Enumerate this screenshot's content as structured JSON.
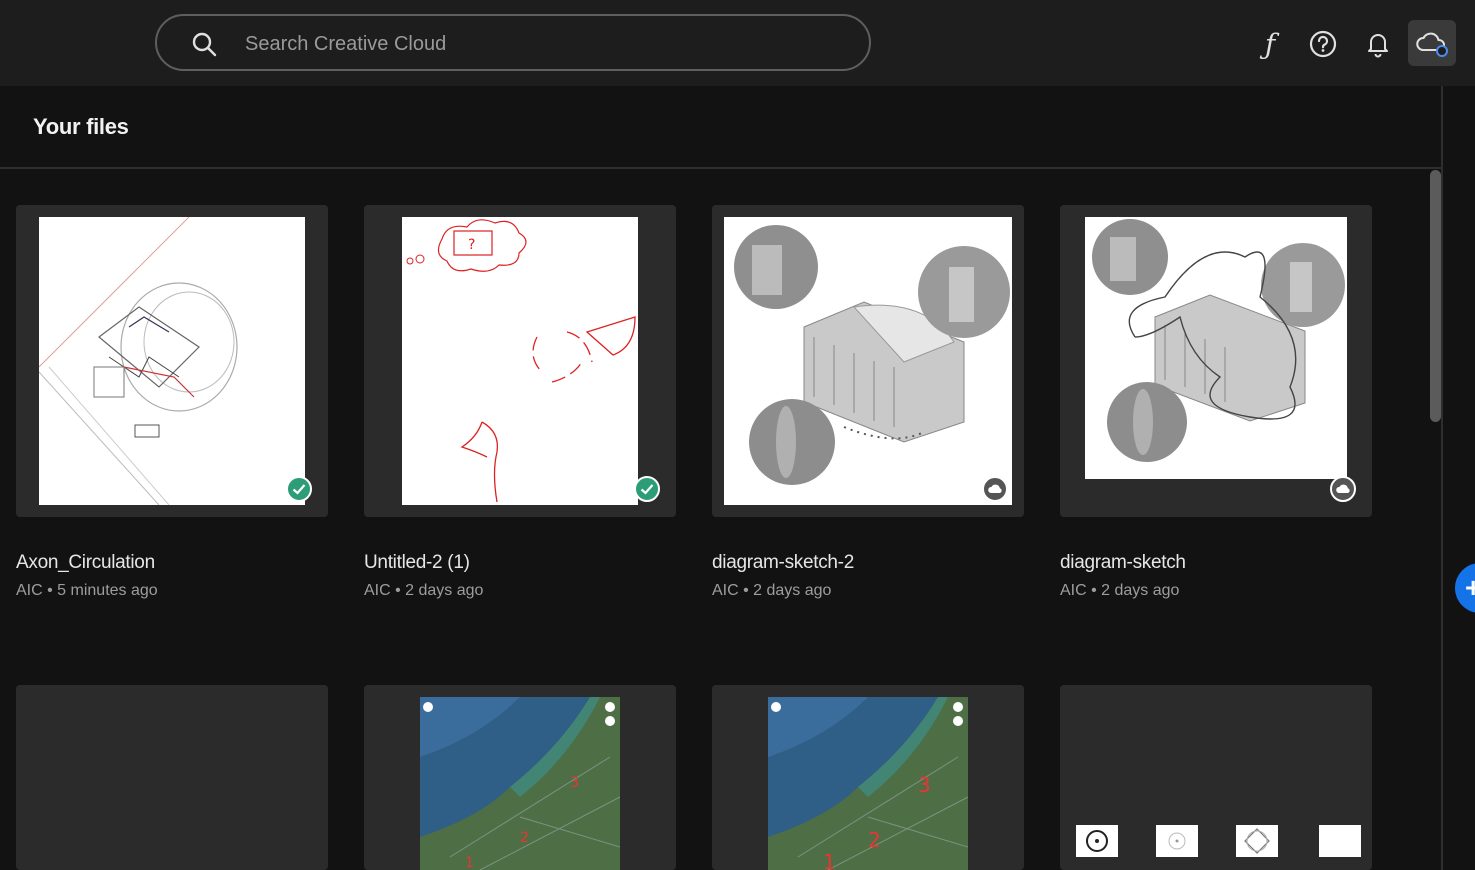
{
  "search": {
    "placeholder": "Search Creative Cloud",
    "icon": "search-icon"
  },
  "toolbar": {
    "icons": [
      "fonts-icon",
      "help-icon",
      "notifications-bell-icon",
      "cloud-sync-icon"
    ]
  },
  "page_title": "Your files",
  "files": [
    {
      "name": "Axon_Circulation",
      "meta": "AIC • 5 minutes ago",
      "status": "synced"
    },
    {
      "name": "Untitled-2 (1)",
      "meta": "AIC • 2 days ago",
      "status": "synced"
    },
    {
      "name": "diagram-sketch-2",
      "meta": "AIC • 2 days ago",
      "status": "cloud-only"
    },
    {
      "name": "diagram-sketch",
      "meta": "AIC • 2 days ago",
      "status": "cloud-only"
    }
  ],
  "colors": {
    "background": "#121212",
    "topbar": "#1d1d1d",
    "card": "#2b2b2b",
    "synced": "#2d9d78",
    "accent": "#1473e6"
  }
}
